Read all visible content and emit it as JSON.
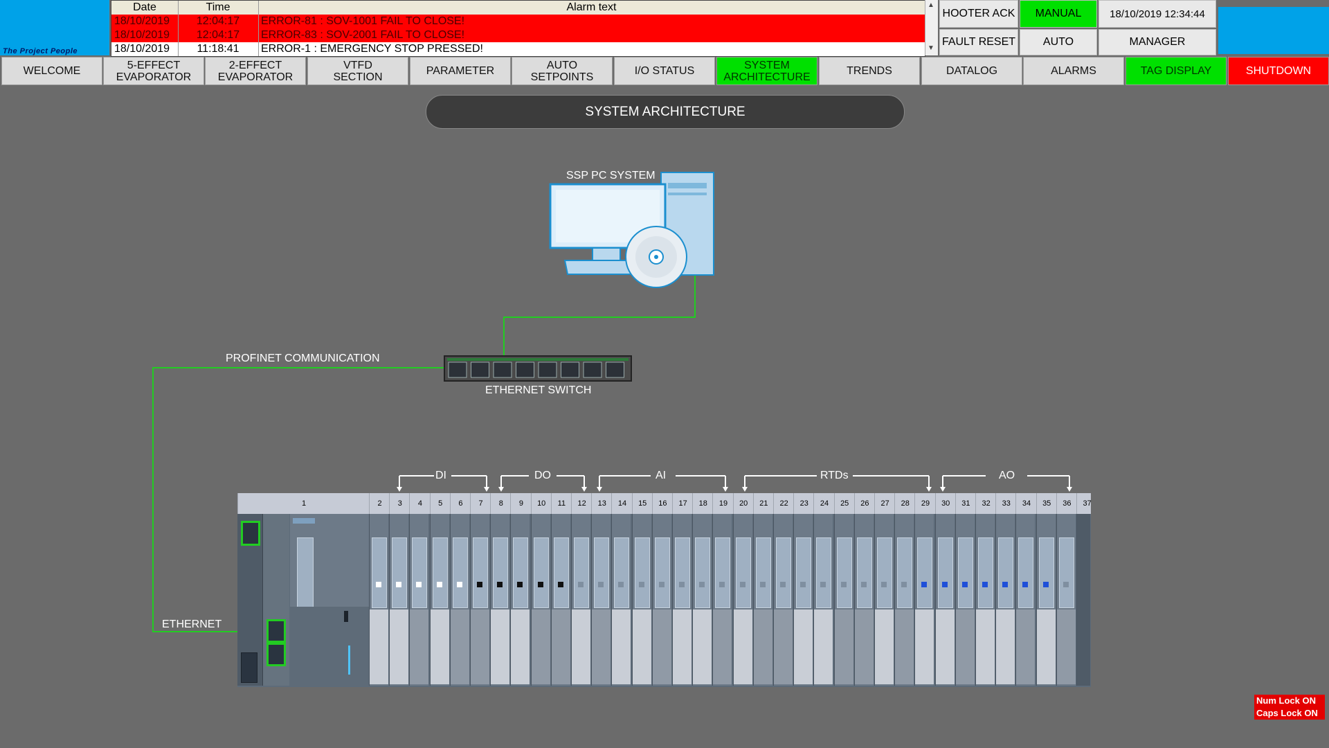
{
  "header": {
    "logo_text": "The Project People",
    "alarm_columns": [
      "Date",
      "Time",
      "Alarm text"
    ],
    "alarms": [
      {
        "date": "18/10/2019",
        "time": "12:04:17",
        "text": "ERROR-81 : SOV-1001 FAIL TO CLOSE!",
        "state": "active"
      },
      {
        "date": "18/10/2019",
        "time": "12:04:17",
        "text": "ERROR-83 : SOV-2001 FAIL TO CLOSE!",
        "state": "active"
      },
      {
        "date": "18/10/2019",
        "time": "11:18:41",
        "text": "ERROR-1 : EMERGENCY STOP PRESSED!",
        "state": "normal"
      }
    ],
    "hooter_ack": "HOOTER ACK",
    "fault_reset": "FAULT RESET",
    "manual": "MANUAL",
    "auto": "AUTO",
    "datetime": "18/10/2019 12:34:44",
    "user": "MANAGER"
  },
  "nav": [
    {
      "label": "WELCOME",
      "style": "normal"
    },
    {
      "label": "5-EFFECT\nEVAPORATOR",
      "style": "normal"
    },
    {
      "label": "2-EFFECT\nEVAPORATOR",
      "style": "normal"
    },
    {
      "label": "VTFD\nSECTION",
      "style": "normal"
    },
    {
      "label": "PARAMETER",
      "style": "normal"
    },
    {
      "label": "AUTO\nSETPOINTS",
      "style": "normal"
    },
    {
      "label": "I/O STATUS",
      "style": "normal"
    },
    {
      "label": "SYSTEM\nARCHITECTURE",
      "style": "green"
    },
    {
      "label": "TRENDS",
      "style": "normal"
    },
    {
      "label": "DATALOG",
      "style": "normal"
    },
    {
      "label": "ALARMS",
      "style": "normal"
    },
    {
      "label": "TAG DISPLAY",
      "style": "green"
    },
    {
      "label": "SHUTDOWN",
      "style": "red"
    }
  ],
  "main": {
    "title": "SYSTEM ARCHITECTURE",
    "pc_label": "SSP PC SYSTEM",
    "profinet_label": "PROFINET COMMUNICATION",
    "switch_label": "ETHERNET SWITCH",
    "ethernet_label": "ETHERNET",
    "io_groups": [
      "DI",
      "DO",
      "AI",
      "RTDs",
      "AO"
    ],
    "slots": [
      "1",
      "2",
      "3",
      "4",
      "5",
      "6",
      "7",
      "8",
      "9",
      "10",
      "11",
      "12",
      "13",
      "14",
      "15",
      "16",
      "17",
      "18",
      "19",
      "20",
      "21",
      "22",
      "23",
      "24",
      "25",
      "26",
      "27",
      "28",
      "29",
      "30",
      "31",
      "32",
      "33",
      "34",
      "35",
      "36",
      "37"
    ]
  },
  "status": {
    "num_lock": "Num Lock ON",
    "caps_lock": "Caps Lock ON"
  },
  "colors": {
    "background": "#6b6b6b",
    "alarm_active": "#ff0000",
    "active_button": "#00e000",
    "shutdown": "#ff0000",
    "logo_blue": "#00a2e8",
    "link_line": "#22cc22"
  }
}
